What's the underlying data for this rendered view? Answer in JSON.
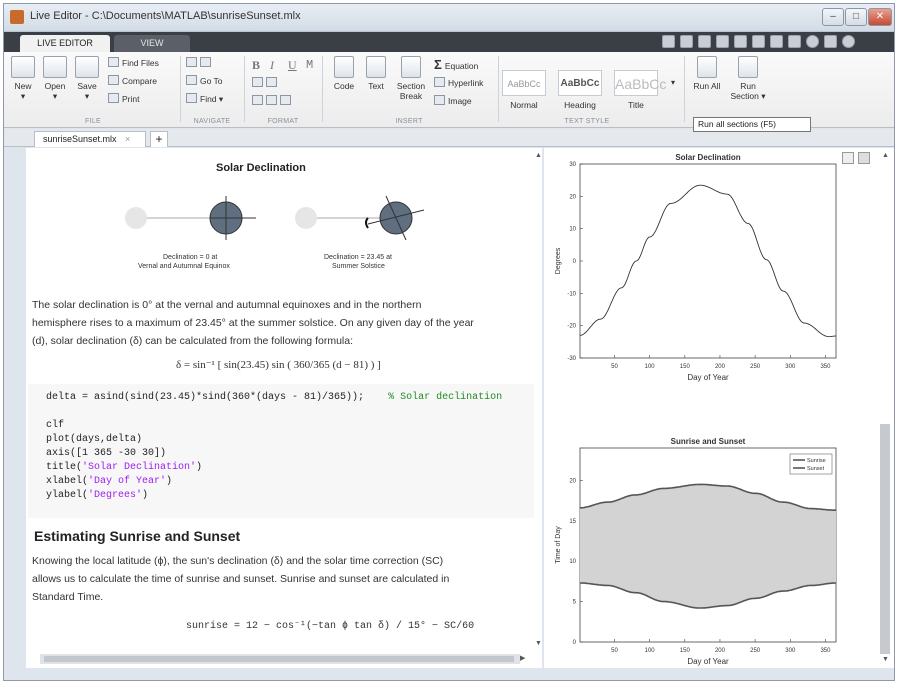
{
  "window": {
    "title": "Live Editor - C:\\Documents\\MATLAB\\sunriseSunset.mlx"
  },
  "ribbon_tabs": [
    "LIVE EDITOR",
    "VIEW"
  ],
  "file_group": {
    "new": "New",
    "open": "Open",
    "save": "Save",
    "find_files": "Find Files",
    "compare": "Compare",
    "print": "Print",
    "label": "FILE"
  },
  "navigate_group": {
    "go_to": "Go To",
    "find": "Find",
    "label": "NAVIGATE"
  },
  "format_group": {
    "bold": "B",
    "italic": "I",
    "underline": "U",
    "mono": "M",
    "label": "FORMAT"
  },
  "insert_group": {
    "code": "Code",
    "text": "Text",
    "section_break_1": "Section",
    "section_break_2": "Break",
    "equation": "Equation",
    "hyperlink": "Hyperlink",
    "image": "Image",
    "label": "INSERT"
  },
  "text_style_group": {
    "sample": "AaBbCc",
    "normal": "Normal",
    "heading": "Heading",
    "title": "Title",
    "label": "TEXT STYLE"
  },
  "run_group": {
    "run_all": "Run All",
    "run_section_1": "Run",
    "run_section_2": "Section"
  },
  "tooltip": "Run all sections (F5)",
  "doc_tab": {
    "name": "sunriseSunset.mlx",
    "close": "×",
    "add": "+"
  },
  "editor": {
    "section1_title": "Solar Declination",
    "fig_caption_left_1": "Declination = 0 at",
    "fig_caption_left_2": "Vernal and Autumnal Equinox",
    "fig_caption_right_1": "Declination = 23.45 at",
    "fig_caption_right_2": "Summer Solstice",
    "para1_line1": "The solar declination is 0° at the vernal and autumnal equinoxes and in the northern",
    "para1_line2": "hemisphere rises to a maximum of 23.45° at the summer solstice. On any given day of the year",
    "para1_line3": "(d), solar declination (δ) can be calculated from the following formula:",
    "formula1": "δ = sin⁻¹ [ sin(23.45) sin ( 360/365 (d − 81) ) ]",
    "code_line1": "delta = asind(sind(23.45)*sind(360*(days - 81)/365));",
    "code_comment1": "% Solar declination",
    "code_line2": "clf",
    "code_line3": "plot(days,delta)",
    "code_line4": "axis([1 365 -30 30])",
    "code_line5_a": "title(",
    "code_line5_b": "'Solar Declination'",
    "code_line5_c": ")",
    "code_line6_a": "xlabel(",
    "code_line6_b": "'Day of Year'",
    "code_line6_c": ")",
    "code_line7_a": "ylabel(",
    "code_line7_b": "'Degrees'",
    "code_line7_c": ")",
    "section2_title": "Estimating Sunrise and Sunset",
    "para2_line1": "Knowing the local latitude (ϕ), the sun's declination (δ) and the solar time correction (SC)",
    "para2_line2": "allows us to calculate the time of sunrise and sunset. Sunrise and sunset are calculated in",
    "para2_line3": "Standard Time.",
    "formula2": "sunrise = 12 − cos⁻¹(−tan ϕ tan δ) / 15° − SC/60"
  },
  "chart_data": [
    {
      "type": "line",
      "title": "Solar Declination",
      "xlabel": "Day of Year",
      "ylabel": "Degrees",
      "xlim": [
        1,
        365
      ],
      "ylim": [
        -30,
        30
      ],
      "xticks": [
        50,
        100,
        150,
        200,
        250,
        300,
        350
      ],
      "yticks": [
        -30,
        -20,
        -10,
        0,
        10,
        20,
        30
      ],
      "series": [
        {
          "x": [
            1,
            30,
            60,
            81,
            100,
            130,
            172,
            210,
            240,
            266,
            290,
            320,
            355,
            365
          ],
          "y": [
            -23.0,
            -18.0,
            -8.3,
            0,
            7.4,
            17.8,
            23.45,
            20.7,
            11.6,
            0.4,
            -9.3,
            -19.2,
            -23.4,
            -23.2
          ]
        }
      ]
    },
    {
      "type": "area",
      "title": "Sunrise and Sunset",
      "xlabel": "Day of Year",
      "ylabel": "Time of Day",
      "xlim": [
        1,
        365
      ],
      "ylim": [
        0,
        24
      ],
      "xticks": [
        50,
        100,
        150,
        200,
        250,
        300,
        350
      ],
      "yticks": [
        0,
        5,
        10,
        15,
        20
      ],
      "legend": [
        "Sunrise",
        "Sunset"
      ],
      "legend_position": "top-right",
      "fill_color": "#d3d3d3",
      "series": [
        {
          "name": "Sunrise",
          "x": [
            1,
            40,
            80,
            120,
            172,
            210,
            250,
            290,
            330,
            365
          ],
          "y": [
            7.3,
            7.0,
            6.1,
            5.0,
            4.2,
            4.5,
            5.4,
            6.3,
            7.0,
            7.3
          ]
        },
        {
          "name": "Sunset",
          "x": [
            1,
            40,
            80,
            120,
            172,
            210,
            250,
            290,
            330,
            365
          ],
          "y": [
            16.6,
            17.3,
            18.2,
            19.0,
            19.5,
            19.3,
            18.4,
            17.3,
            16.5,
            16.3
          ]
        }
      ]
    }
  ]
}
